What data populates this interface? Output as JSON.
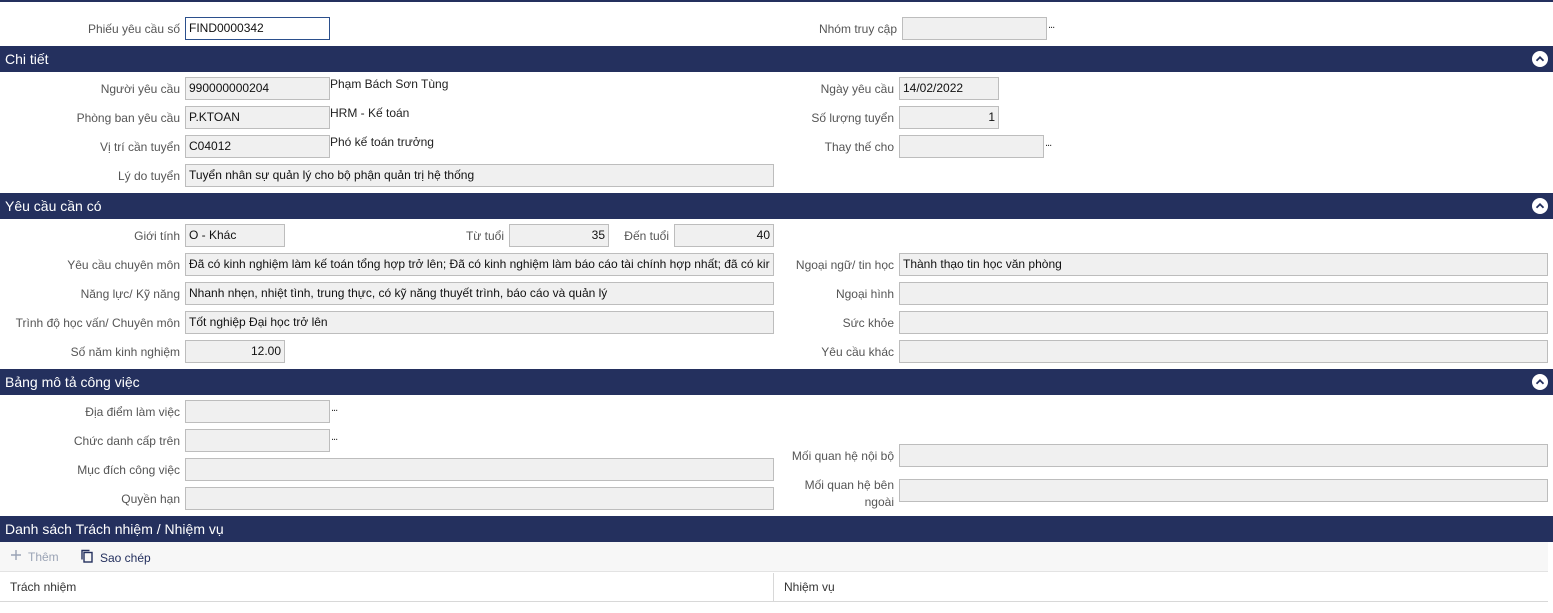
{
  "header": {
    "request_no_label": "Phiếu yêu cầu số",
    "request_no_value": "FIND0000342",
    "access_group_label": "Nhóm truy cập",
    "access_group_value": "",
    "lookup_glyph": "..."
  },
  "details": {
    "title": "Chi tiết",
    "requester_label": "Người yêu cầu",
    "requester_code": "990000000204",
    "requester_name": "Phạm Bách Sơn Tùng",
    "request_date_label": "Ngày yêu cầu",
    "request_date": "14/02/2022",
    "dept_label": "Phòng ban yêu cầu",
    "dept_code": "P.KTOAN",
    "dept_name": "HRM - Kế toán",
    "quantity_label": "Số lượng tuyển",
    "quantity": "1",
    "position_label": "Vị trí cần tuyển",
    "position_code": "C04012",
    "position_name": "Phó kế toán trưởng",
    "replace_label": "Thay thế cho",
    "replace_value": "",
    "reason_label": "Lý do tuyển",
    "reason_value": "Tuyển nhân sự quản lý cho bộ phận quản trị hệ thống"
  },
  "requirements": {
    "title": "Yêu cầu cần có",
    "gender_label": "Giới tính",
    "gender_value": "O - Khác",
    "age_from_label": "Từ tuổi",
    "age_from": "35",
    "age_to_label": "Đến tuổi",
    "age_to": "40",
    "expertise_label": "Yêu cầu chuyên môn",
    "expertise_value": "Đã có kinh nghiệm làm kế toán tổng hợp trở lên; Đã có kinh nghiệm làm báo cáo tài chính hợp nhất; đã có kir",
    "language_label": "Ngoại ngữ/ tin học",
    "language_value": "Thành thạo tin học văn phòng",
    "skills_label": "Năng lực/ Kỹ năng",
    "skills_value": "Nhanh nhẹn, nhiệt tình, trung thực, có kỹ năng thuyết trình, báo cáo và quản lý",
    "appearance_label": "Ngoại hình",
    "appearance_value": "",
    "education_label": "Trình độ học vấn/ Chuyên môn",
    "education_value": "Tốt nghiệp Đại học trở lên",
    "health_label": "Sức khỏe",
    "health_value": "",
    "experience_label": "Số năm kinh nghiệm",
    "experience_value": "12.00",
    "other_label": "Yêu cầu khác",
    "other_value": ""
  },
  "job_description": {
    "title": "Bảng mô tả công việc",
    "location_label": "Địa điểm làm việc",
    "location_value": "",
    "superior_label": "Chức danh cấp trên",
    "superior_value": "",
    "purpose_label": "Mục đích công việc",
    "purpose_value": "",
    "internal_label": "Mối quan hệ nội bộ",
    "internal_value": "",
    "authority_label": "Quyền hạn",
    "authority_value": "",
    "external_label_1": "Mối quan hệ bên",
    "external_label_2": "ngoài",
    "external_value": ""
  },
  "duties": {
    "title": "Danh sách Trách nhiệm / Nhiệm vụ",
    "add_label": "Thêm",
    "copy_label": "Sao chép",
    "columns": [
      "Trách nhiệm",
      "Nhiệm vụ"
    ]
  },
  "icons": {
    "collapse": "chevron-up-circle-icon",
    "add": "plus-icon",
    "copy": "copy-icon"
  },
  "colors": {
    "section_bar": "#24305e",
    "input_bg": "#f0f0f0",
    "input_border": "#bdbdbd"
  }
}
